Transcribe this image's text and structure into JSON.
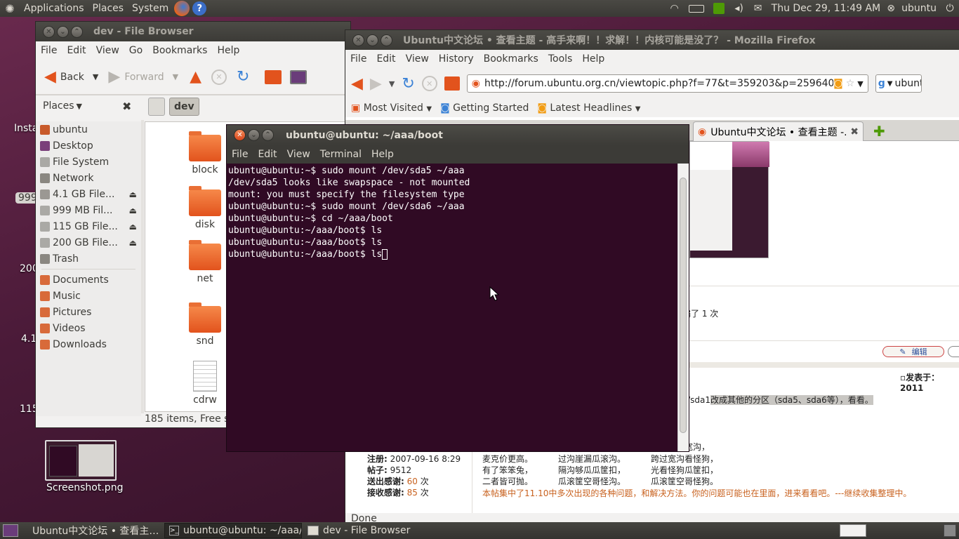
{
  "top_panel": {
    "menus": [
      "Applications",
      "Places",
      "System"
    ],
    "clock": "Thu Dec 29, 11:49 AM",
    "user": "ubuntu"
  },
  "desktop": {
    "partial_labels": [
      "Insta",
      "999",
      "200",
      "4.1",
      "115"
    ],
    "screenshot_label": "Screenshot.png"
  },
  "file_browser": {
    "title": "dev - File Browser",
    "menu": [
      "File",
      "Edit",
      "View",
      "Go",
      "Bookmarks",
      "Help"
    ],
    "back": "Back",
    "forward": "Forward",
    "places_label": "Places",
    "crumb": "dev",
    "sidebar": [
      {
        "label": "ubuntu",
        "color": "#c85a2a",
        "eject": false
      },
      {
        "label": "Desktop",
        "color": "#7a3f7a",
        "eject": false
      },
      {
        "label": "File System",
        "color": "#aaa9a5",
        "eject": false
      },
      {
        "label": "Network",
        "color": "#8a8781",
        "eject": false
      },
      {
        "label": "4.1 GB File...",
        "color": "#9b9893",
        "eject": true
      },
      {
        "label": "999 MB Fil...",
        "color": "#aaa9a5",
        "eject": true
      },
      {
        "label": "115 GB File...",
        "color": "#aaa9a5",
        "eject": true
      },
      {
        "label": "200 GB File...",
        "color": "#aaa9a5",
        "eject": true
      },
      {
        "label": "Trash",
        "color": "#8a8781",
        "eject": false
      }
    ],
    "bookmarks": [
      {
        "label": "Documents",
        "color": "#d86a3a"
      },
      {
        "label": "Music",
        "color": "#d86a3a"
      },
      {
        "label": "Pictures",
        "color": "#d86a3a"
      },
      {
        "label": "Videos",
        "color": "#d86a3a"
      },
      {
        "label": "Downloads",
        "color": "#d86a3a"
      }
    ],
    "files": [
      "block",
      "disk",
      "net",
      "snd",
      "cdrw"
    ],
    "status": "185 items, Free sp"
  },
  "firefox": {
    "title": "Ubuntu中文论坛 • 查看主题 - 高手来啊！！求解！！内核可能是没了？ - Mozilla Firefox",
    "menu": [
      "File",
      "Edit",
      "View",
      "History",
      "Bookmarks",
      "Tools",
      "Help"
    ],
    "url": "http://forum.ubuntu.org.cn/viewtopic.php?f=77&t=359203&p=2596402#p",
    "search": "ubuntu",
    "bookmarks": [
      "Most Visited",
      "Getting Started",
      "Latest Headlines"
    ],
    "tab": "Ubuntu中文论坛 • 查看主题 -...",
    "edit_btn": "编辑",
    "post_fragment_1": "编了 1 次",
    "posted_label": "发表于：2011",
    "post_fragment_2": "v/sda1",
    "post_highlight": "改成其他的分区（sda5、sda6等），看看。",
    "post_fragment_3": "宽沟，",
    "user_info": [
      {
        "label": "注册:",
        "value": "2007-09-16 8:29"
      },
      {
        "label": "帖子:",
        "value": "9512"
      },
      {
        "label": "送出感谢:",
        "value": "60",
        "unit": "次"
      },
      {
        "label": "接收感谢:",
        "value": "85",
        "unit": "次"
      }
    ],
    "poem": [
      [
        "麦克价更高。",
        "过沟崖漏瓜滚沟。",
        "跨过宽沟看怪狗，"
      ],
      [
        "有了笨笨兔，",
        "隔沟够瓜瓜筐扣，",
        "光看怪狗瓜筐扣，"
      ],
      [
        "二者皆可抛。",
        "瓜滚筐空哥怪沟。",
        "瓜滚筐空哥怪狗。"
      ]
    ],
    "signature": "本帖集中了11.10中多次出现的各种问题，和解决方法。你的问题可能也在里面，进来看看吧。---继续收集整理中。",
    "status": "Done"
  },
  "terminal": {
    "title": "ubuntu@ubuntu: ~/aaa/boot",
    "menu": [
      "File",
      "Edit",
      "View",
      "Terminal",
      "Help"
    ],
    "lines": [
      "ubuntu@ubuntu:~$ sudo mount /dev/sda5 ~/aaa",
      "/dev/sda5 looks like swapspace - not mounted",
      "mount: you must specify the filesystem type",
      "ubuntu@ubuntu:~$ sudo mount /dev/sda6 ~/aaa",
      "ubuntu@ubuntu:~$ cd ~/aaa/boot",
      "ubuntu@ubuntu:~/aaa/boot$ ls",
      "ubuntu@ubuntu:~/aaa/boot$ ls",
      "ubuntu@ubuntu:~/aaa/boot$ ls"
    ]
  },
  "taskbar": [
    {
      "label": "Ubuntu中文论坛 • 查看主…",
      "active": false
    },
    {
      "label": "ubuntu@ubuntu: ~/aaa/...",
      "active": true
    },
    {
      "label": "dev - File Browser",
      "active": false
    }
  ],
  "colors": {
    "terminal_bg": "#300a24",
    "panel": "#3c3b37",
    "accent": "#e2531d"
  }
}
